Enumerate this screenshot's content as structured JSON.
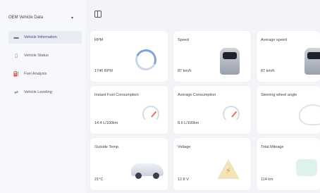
{
  "app": {
    "title": "OEM Vehicle Data"
  },
  "sidebar": {
    "items": [
      {
        "label": "Vehicle Information",
        "icon": "car-icon",
        "active": true
      },
      {
        "label": "Vehicle Status",
        "icon": "phone-icon",
        "active": false
      },
      {
        "label": "Fuel Analysis",
        "icon": "fuel-icon",
        "active": false
      },
      {
        "label": "Vehicle Leveling",
        "icon": "level-icon",
        "active": false
      }
    ]
  },
  "cards": [
    {
      "title": "RPM",
      "value": "1740 RPM",
      "art": "gauge-icon"
    },
    {
      "title": "Speed",
      "value": "87 km/h",
      "art": "car-front-icon"
    },
    {
      "title": "Average speed",
      "value": "87 km/h",
      "art": "car-front-icon"
    },
    {
      "title": "Instant Fuel Consumption",
      "value": "14.4 L/100km",
      "art": "speedometer-icon"
    },
    {
      "title": "Average Consumption",
      "value": "8.6 L/100km",
      "art": "speedometer-icon"
    },
    {
      "title": "Steering wheel angle",
      "value": "",
      "art": "steering-wheel-icon"
    },
    {
      "title": "Outside Temp.",
      "value": "21°C",
      "art": "sedan-icon"
    },
    {
      "title": "Voltage",
      "value": "12.8 V",
      "art": "warning-icon"
    },
    {
      "title": "Total Mileage",
      "value": "114 km",
      "art": "odometer-icon"
    }
  ]
}
